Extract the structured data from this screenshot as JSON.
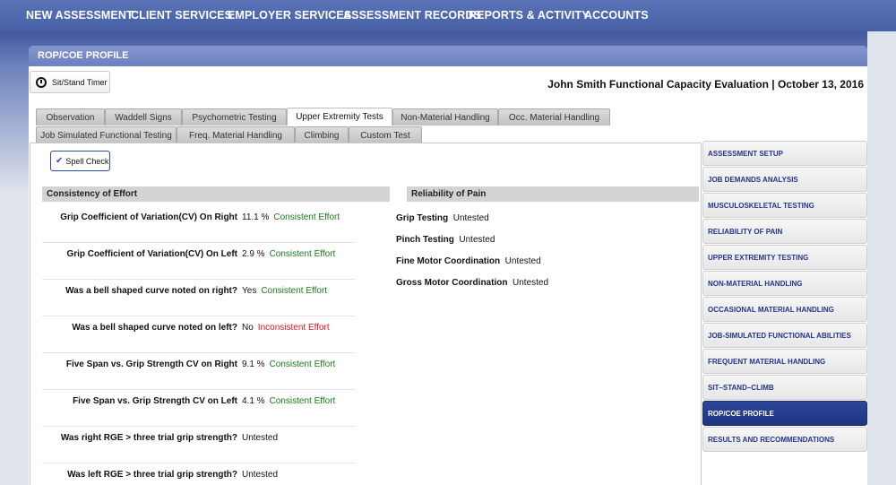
{
  "topnav": {
    "items": [
      "NEW ASSESSMENT",
      "CLIENT SERVICES",
      "EMPLOYER SERVICES",
      "ASSESSMENT RECORDS",
      "REPORTS & ACTIVITY",
      "ACCOUNTS"
    ]
  },
  "panel": {
    "title": "ROP/COE PROFILE",
    "timer_label": "Sit/Stand Timer",
    "evaluation_title": "John Smith Functional Capacity Evaluation | October 13, 2016"
  },
  "tabs": {
    "row1": [
      "Observation",
      "Waddell Signs",
      "Psychometric Testing",
      "Upper Extremity Tests",
      "Non-Material Handling",
      "Occ. Material Handling"
    ],
    "row2": [
      "Job Simulated Functional Testing",
      "Freq. Material Handling",
      "Climbing",
      "Custom Test"
    ],
    "active": "Upper Extremity Tests"
  },
  "content": {
    "spell_check_label": "Spell Check",
    "consistency": {
      "heading": "Consistency of Effort",
      "rows": [
        {
          "label": "Grip Coefficient of Variation(CV) On Right",
          "value": "11.1 %",
          "status": "Consistent Effort"
        },
        {
          "label": "Grip Coefficient of Variation(CV) On Left",
          "value": "2.9 %",
          "status": "Consistent Effort"
        },
        {
          "label": "Was a bell shaped curve noted on right?",
          "value": "Yes",
          "status": "Consistent Effort"
        },
        {
          "label": "Was a bell shaped curve noted on left?",
          "value": "No",
          "status": "Inconsistent Effort"
        },
        {
          "label": "Five Span vs. Grip Strength CV on Right",
          "value": "9.1 %",
          "status": "Consistent Effort"
        },
        {
          "label": "Five Span vs. Grip Strength CV on Left",
          "value": "4.1 %",
          "status": "Consistent Effort"
        },
        {
          "label": "Was right RGE > three trial grip strength?",
          "value": "Untested",
          "status": ""
        },
        {
          "label": "Was left RGE > three trial grip strength?",
          "value": "Untested",
          "status": ""
        }
      ]
    },
    "pain": {
      "heading": "Reliability of Pain",
      "rows": [
        {
          "label": "Grip Testing",
          "value": "Untested"
        },
        {
          "label": "Pinch Testing",
          "value": "Untested"
        },
        {
          "label": "Fine Motor Coordination",
          "value": "Untested"
        },
        {
          "label": "Gross Motor Coordination",
          "value": "Untested"
        }
      ]
    }
  },
  "sidebar": {
    "items": [
      "ASSESSMENT SETUP",
      "JOB DEMANDS ANALYSIS",
      "MUSCULOSKELETAL TESTING",
      "RELIABILITY OF PAIN",
      "UPPER EXTREMITY TESTING",
      "NON-MATERIAL HANDLING",
      "OCCASIONAL MATERIAL HANDLING",
      "JOB-SIMULATED FUNCTIONAL ABILITIES",
      "FREQUENT MATERIAL HANDLING",
      "SIT–STAND–CLIMB",
      "ROP/COE PROFILE",
      "RESULTS AND RECOMMENDATIONS"
    ],
    "active": "ROP/COE PROFILE"
  },
  "colors": {
    "nav": "#4a63a8",
    "consistent": "#1b7a1b",
    "inconsistent": "#e3151a",
    "active_side": "#24397f"
  }
}
